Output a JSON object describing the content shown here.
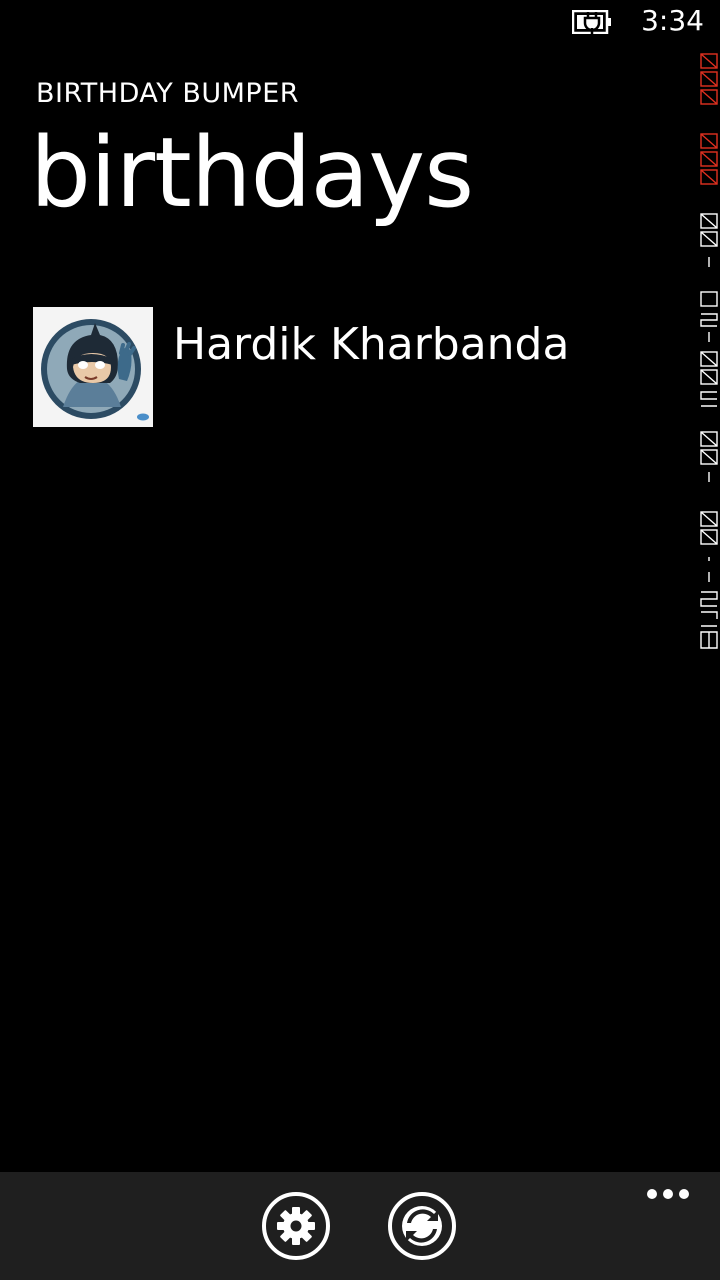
{
  "status_bar": {
    "time": "3:34",
    "battery_icon": "battery-charging-icon"
  },
  "header": {
    "app_title": "BIRTHDAY BUMPER",
    "page_title": "birthdays"
  },
  "birthdays": [
    {
      "name": "Hardik Kharbanda",
      "avatar_icon": "batman-avatar-icon"
    }
  ],
  "app_bar": {
    "buttons": [
      {
        "icon": "settings-icon"
      },
      {
        "icon": "sync-icon"
      }
    ],
    "more_icon": "ellipsis-icon"
  },
  "colors": {
    "background": "#000000",
    "app_bar": "#1f1f1f",
    "text": "#ffffff",
    "perf_counter_red": "#e03020"
  }
}
